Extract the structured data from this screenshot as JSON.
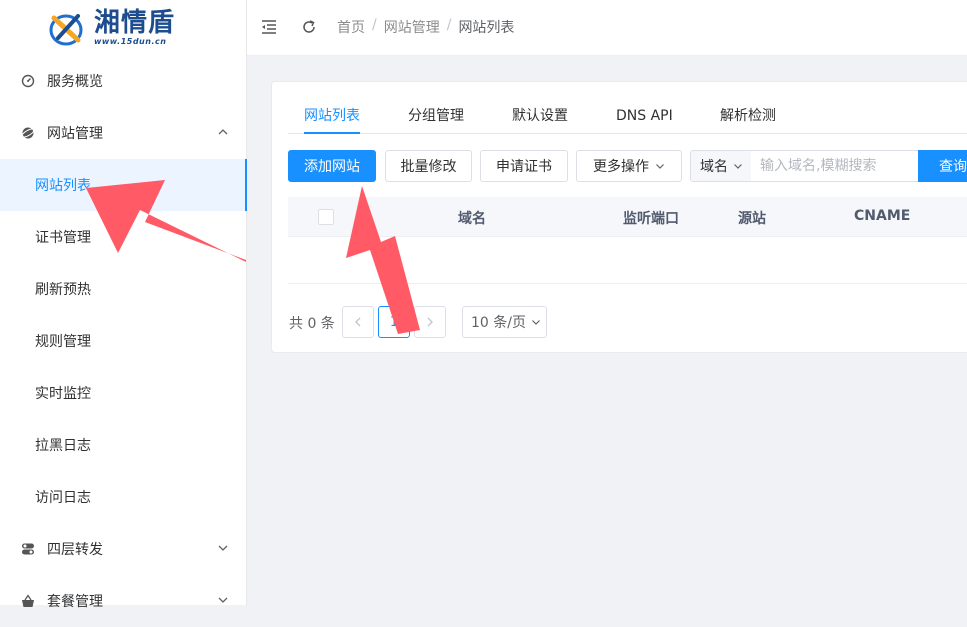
{
  "logo": {
    "title": "湘情盾",
    "subtitle": "www.15dun.cn"
  },
  "sidebar": {
    "items": [
      {
        "label": "服务概览",
        "icon": "dashboard-icon"
      },
      {
        "label": "网站管理",
        "icon": "globe-icon",
        "expanded": true
      },
      {
        "label": "四层转发",
        "icon": "toggle-icon"
      },
      {
        "label": "套餐管理",
        "icon": "package-icon"
      }
    ],
    "sub_items": [
      "网站列表",
      "证书管理",
      "刷新预热",
      "规则管理",
      "实时监控",
      "拉黑日志",
      "访问日志"
    ],
    "active_sub": "网站列表"
  },
  "topbar": {
    "breadcrumb": [
      "首页",
      "网站管理",
      "网站列表"
    ],
    "separator": "/"
  },
  "tabs": [
    "网站列表",
    "分组管理",
    "默认设置",
    "DNS API",
    "解析检测"
  ],
  "toolbar": {
    "add_site": "添加网站",
    "bulk_edit": "批量修改",
    "apply_cert": "申请证书",
    "more_actions": "更多操作",
    "search_field": "域名",
    "search_placeholder": "输入域名,模糊搜索",
    "search_button": "查询"
  },
  "table": {
    "columns": [
      "域名",
      "监听端口",
      "源站",
      "CNAME"
    ]
  },
  "pagination": {
    "total_text": "共 0 条",
    "current_page": "1",
    "page_size": "10 条/页"
  },
  "colors": {
    "primary": "#1890ff",
    "annotation_arrow": "#ff5a66"
  }
}
